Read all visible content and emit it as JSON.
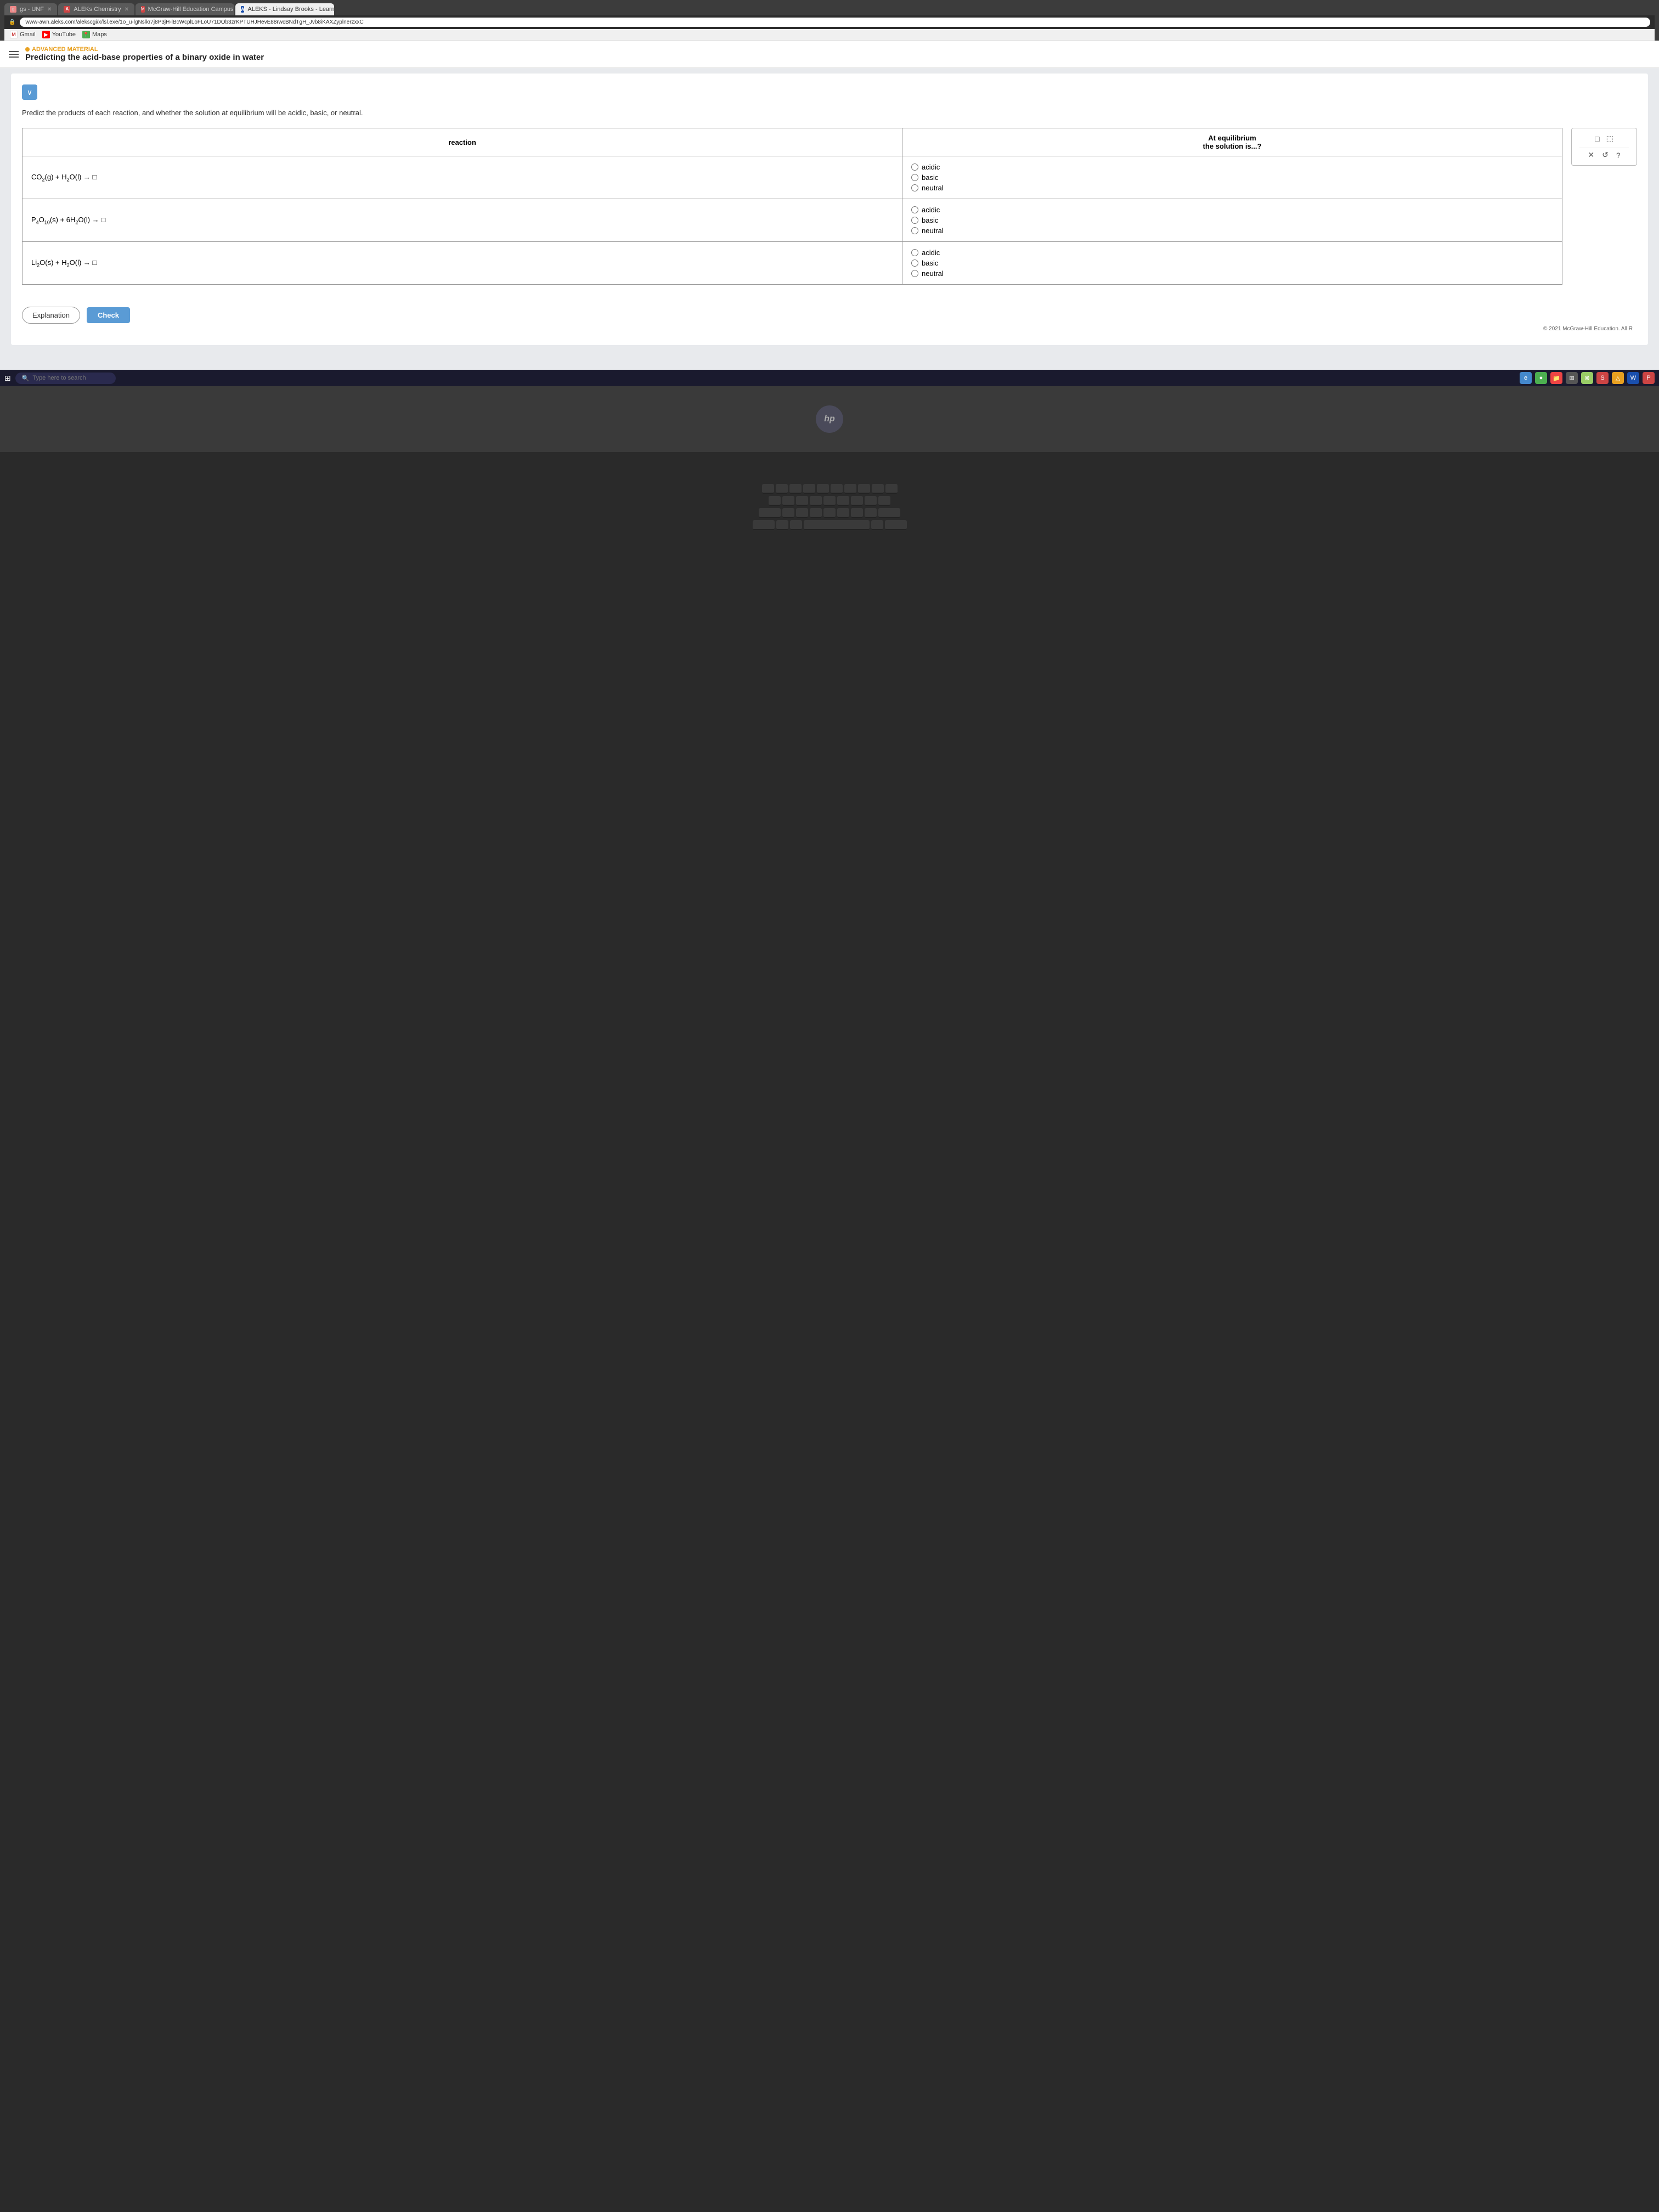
{
  "browser": {
    "tabs": [
      {
        "id": "gs-unf",
        "label": "gs - UNF",
        "favicon": "gs",
        "active": false
      },
      {
        "id": "aleks-chem",
        "label": "ALEKs Chemistry",
        "favicon": "aleks",
        "active": false
      },
      {
        "id": "mcgraw",
        "label": "McGraw-Hill Education Campus",
        "favicon": "mcgraw",
        "active": false
      },
      {
        "id": "aleks-learn",
        "label": "ALEKS - Lindsay Brooks - Learn",
        "favicon": "aleks-a",
        "active": true
      }
    ],
    "url": "www-awn.aleks.com/alekscgi/x/lsl.exe/1o_u-lgNslkr7j8P3jH-lBcWcplLoFLoU71DOb3zrKPTUHJHevE88rwcBNdTgH_Jvb8iKAXZyplnerzxxC",
    "bookmarks": [
      {
        "label": "Gmail",
        "type": "gmail"
      },
      {
        "label": "YouTube",
        "type": "youtube"
      },
      {
        "label": "Maps",
        "type": "maps"
      }
    ]
  },
  "page": {
    "advanced_label": "ADVANCED MATERIAL",
    "title": "Predicting the acid-base properties of a binary oxide in water",
    "instructions": "Predict the products of each reaction, and whether the solution at equilibrium will be acidic, basic, or neutral.",
    "table": {
      "col1_header": "reaction",
      "col2_header": "At equilibrium\nthe solution is...?",
      "rows": [
        {
          "reaction_html": "CO₂(g) + H₂O(l) → □",
          "reaction_parts": {
            "reactant1": "CO",
            "reactant1_sub2": "2",
            "reactant1_phase": "(g)",
            "plus": "+",
            "reactant2": "H",
            "reactant2_sub2": "2",
            "reactant2_sub3": "O",
            "reactant2_phase": "(l)",
            "arrow": "→"
          },
          "options": [
            "acidic",
            "basic",
            "neutral"
          ],
          "selected": null
        },
        {
          "reaction_parts": {
            "reactant1": "P",
            "reactant1_sub1": "4",
            "reactant1_sub2": "O",
            "reactant1_sub3": "10",
            "reactant1_phase": "(s)",
            "plus": "+",
            "reactant2": "6H",
            "reactant2_sub2": "2",
            "reactant2_sub3": "O",
            "reactant2_phase": "(l)",
            "arrow": "→"
          },
          "options": [
            "acidic",
            "basic",
            "neutral"
          ],
          "selected": null
        },
        {
          "reaction_parts": {
            "reactant1": "Li",
            "reactant1_sub2": "2",
            "reactant1_sub3": "O",
            "reactant1_phase": "(s)",
            "plus": "+",
            "reactant2": "H",
            "reactant2_sub2": "2",
            "reactant2_sub3": "O",
            "reactant2_phase": "(l)",
            "arrow": "→"
          },
          "options": [
            "acidic",
            "basic",
            "neutral"
          ],
          "selected": null
        }
      ]
    },
    "buttons": {
      "explanation": "Explanation",
      "check": "Check"
    },
    "copyright": "© 2021 McGraw-Hill Education. All R"
  },
  "taskbar": {
    "search_placeholder": "Type here to search",
    "windows_icon": "⊞"
  }
}
